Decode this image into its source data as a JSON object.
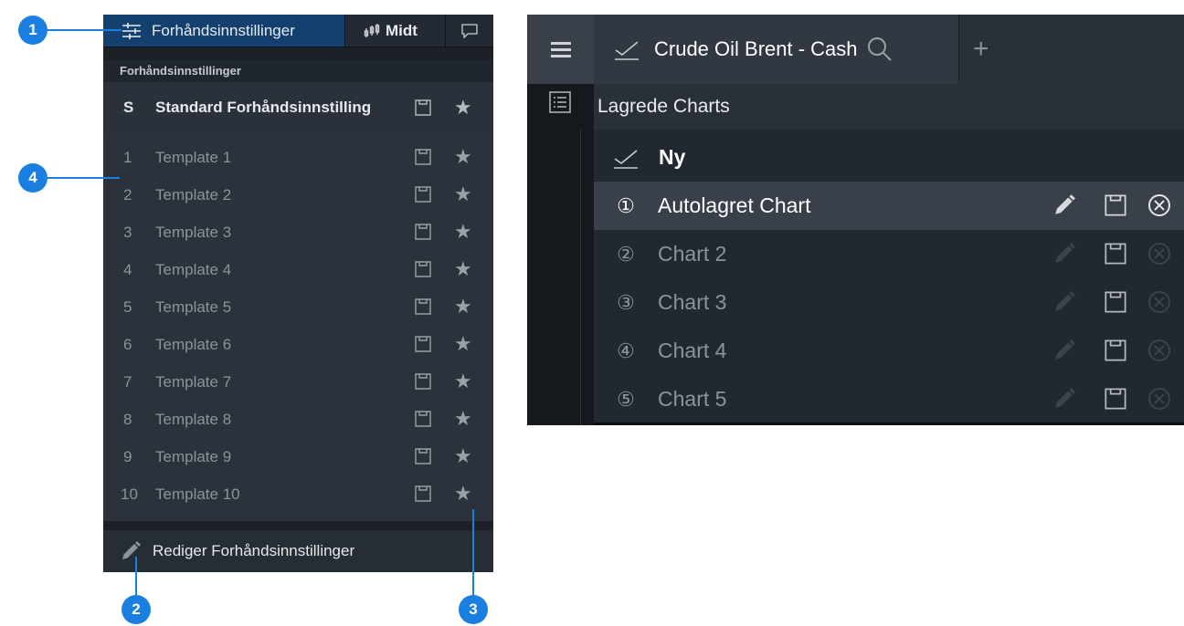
{
  "callouts": [
    "1",
    "2",
    "3",
    "4"
  ],
  "left_panel": {
    "tabs": {
      "presets_label": "Forhåndsinnstillinger",
      "mid_label": "Midt"
    },
    "section_header": "Forhåndsinnstillinger",
    "standard": {
      "key": "S",
      "label": "Standard Forhåndsinnstilling"
    },
    "templates": [
      {
        "num": "1",
        "label": "Template 1"
      },
      {
        "num": "2",
        "label": "Template 2"
      },
      {
        "num": "3",
        "label": "Template 3"
      },
      {
        "num": "4",
        "label": "Template 4"
      },
      {
        "num": "5",
        "label": "Template 5"
      },
      {
        "num": "6",
        "label": "Template 6"
      },
      {
        "num": "7",
        "label": "Template 7"
      },
      {
        "num": "8",
        "label": "Template 8"
      },
      {
        "num": "9",
        "label": "Template 9"
      },
      {
        "num": "10",
        "label": "Template 10"
      }
    ],
    "edit_label": "Rediger Forhåndsinnstillinger"
  },
  "right_panel": {
    "instrument_tab": "Crude Oil Brent - Cash",
    "plus_label": "+",
    "dropdown_header": "Lagrede Charts",
    "new_label": "Ny",
    "charts": [
      {
        "num": "①",
        "label": "Autolagret Chart"
      },
      {
        "num": "②",
        "label": "Chart 2"
      },
      {
        "num": "③",
        "label": "Chart 3"
      },
      {
        "num": "④",
        "label": "Chart 4"
      },
      {
        "num": "⑤",
        "label": "Chart 5"
      }
    ]
  },
  "colors": {
    "callout_blue": "#1a7fe0",
    "active_tab": "#14406f",
    "panel_bg": "#2b323b"
  }
}
